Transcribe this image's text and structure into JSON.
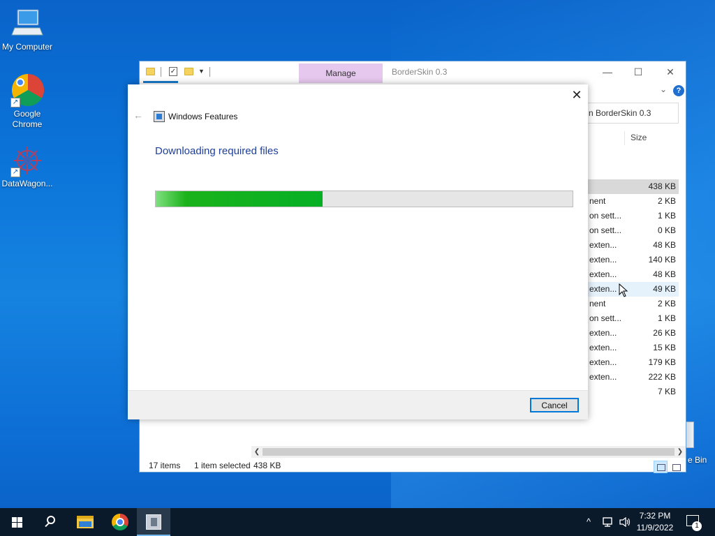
{
  "desktop": {
    "icons": [
      {
        "label": "My Computer",
        "icon": "computer-icon"
      },
      {
        "label": "Google Chrome",
        "icon": "chrome-icon"
      },
      {
        "label": "DataWagon...",
        "icon": "datawagon-icon"
      }
    ],
    "recycle_bin_label": "e Bin"
  },
  "explorer": {
    "title": "BorderSkin 0.3",
    "manage_tab": "Manage",
    "search_text": "n BorderSkin 0.3",
    "column_size": "Size",
    "files": [
      {
        "type": "",
        "size": "438 KB",
        "state": "selected"
      },
      {
        "type": "nent",
        "size": "2 KB"
      },
      {
        "type": "on sett...",
        "size": "1 KB"
      },
      {
        "type": "on sett...",
        "size": "0 KB"
      },
      {
        "type": "exten...",
        "size": "48 KB"
      },
      {
        "type": "exten...",
        "size": "140 KB"
      },
      {
        "type": "exten...",
        "size": "48 KB"
      },
      {
        "type": "exten...",
        "size": "49 KB",
        "state": "hover"
      },
      {
        "type": "nent",
        "size": "2 KB"
      },
      {
        "type": "on sett...",
        "size": "1 KB"
      },
      {
        "type": "exten...",
        "size": "26 KB"
      },
      {
        "type": "exten...",
        "size": "15 KB"
      },
      {
        "type": "exten...",
        "size": "179 KB"
      },
      {
        "type": "exten...",
        "size": "222 KB"
      },
      {
        "type": "",
        "size": "7 KB"
      }
    ],
    "status": {
      "items": "17 items",
      "selected": "1 item selected",
      "selected_size": "438 KB"
    }
  },
  "dialog": {
    "app_name": "Windows Features",
    "heading": "Downloading required files",
    "progress_fraction": 0.4,
    "cancel_label": "Cancel"
  },
  "taskbar": {
    "time": "7:32 PM",
    "date": "11/9/2022",
    "notification_count": "1",
    "apps": [
      "start-icon",
      "search-icon",
      "file-explorer-icon",
      "chrome-icon",
      "windows-features-icon"
    ]
  },
  "colors": {
    "accent": "#0078d7",
    "progress_green": "#06b025",
    "manage_tab": "#e6c8ef",
    "heading_blue": "#1e3f9a"
  }
}
